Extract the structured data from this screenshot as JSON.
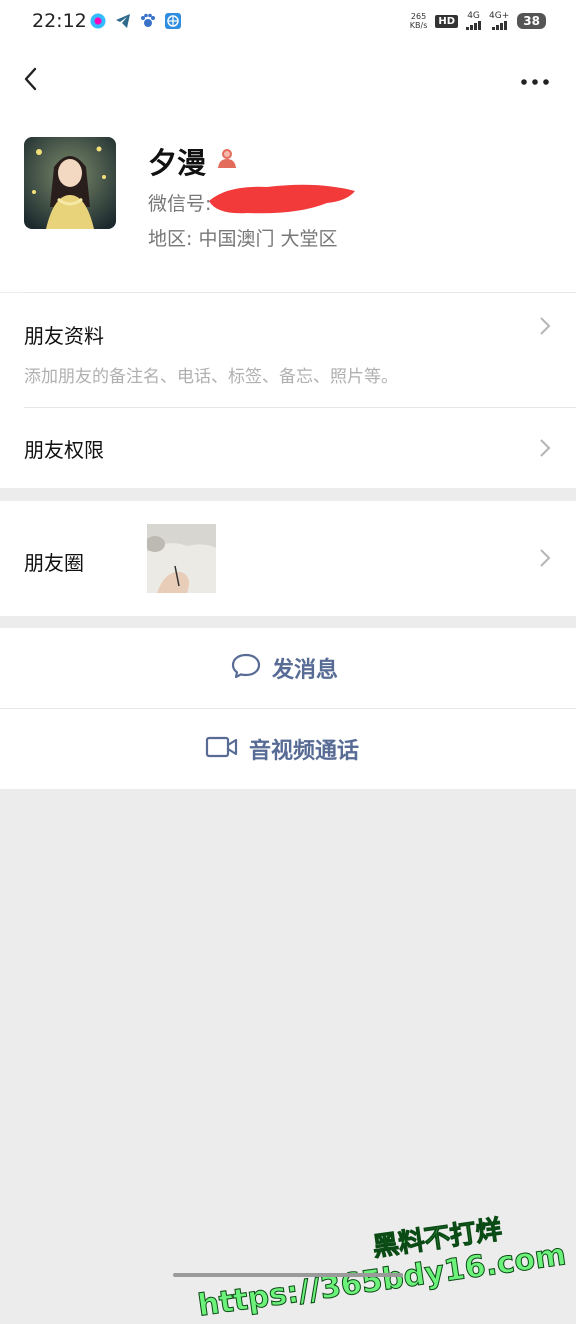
{
  "status_bar": {
    "time": "22:12",
    "net_speed_value": "265",
    "net_speed_unit": "KB/s",
    "hd_label": "HD",
    "signal1_label": "4G",
    "signal2_label": "4G+",
    "battery": "38"
  },
  "profile": {
    "name": "夕漫",
    "wechat_id_label": "微信号:",
    "region": "地区: 中国澳门 大堂区"
  },
  "friend_info": {
    "title": "朋友资料",
    "subtitle": "添加朋友的备注名、电话、标签、备忘、照片等。"
  },
  "friend_permissions": {
    "title": "朋友权限"
  },
  "moments": {
    "title": "朋友圈"
  },
  "actions": {
    "message_label": "发消息",
    "call_label": "音视频通话"
  },
  "watermark": {
    "line1": "黑料不打烊",
    "line2": "https://365bdy16.com"
  },
  "colors": {
    "link_blue": "#576b95",
    "background": "#ececec",
    "watermark_green": "#6cf27a"
  },
  "icons": {
    "back": "back-arrow-icon",
    "more": "more-dots-icon",
    "person": "person-icon",
    "chevron": "chevron-right-icon",
    "chat": "chat-bubble-icon",
    "video": "video-camera-icon"
  }
}
